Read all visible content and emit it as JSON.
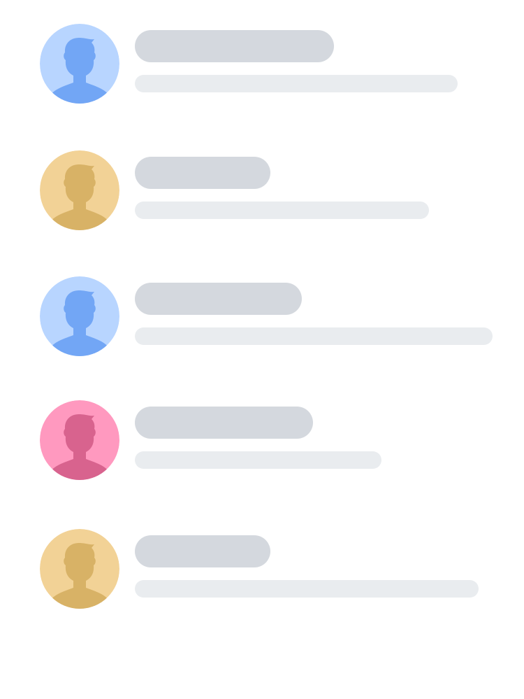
{
  "list": {
    "items": [
      {
        "avatar": {
          "icon": "user-avatar-icon",
          "bg_color": "#b8d5ff",
          "fg_color": "#72a6f5"
        },
        "state": "loading-placeholder"
      },
      {
        "avatar": {
          "icon": "user-avatar-icon",
          "bg_color": "#f2d296",
          "fg_color": "#d8b266"
        },
        "state": "loading-placeholder"
      },
      {
        "avatar": {
          "icon": "user-avatar-icon",
          "bg_color": "#b8d5ff",
          "fg_color": "#72a6f5"
        },
        "state": "loading-placeholder"
      },
      {
        "avatar": {
          "icon": "user-avatar-icon",
          "bg_color": "#ff99bf",
          "fg_color": "#d8638e"
        },
        "state": "loading-placeholder"
      },
      {
        "avatar": {
          "icon": "user-avatar-icon",
          "bg_color": "#f2d296",
          "fg_color": "#d8b266"
        },
        "state": "loading-placeholder"
      }
    ],
    "colors": {
      "title_placeholder": "#d4d8de",
      "subtitle_placeholder": "#e9ecef",
      "background": "#ffffff"
    }
  }
}
